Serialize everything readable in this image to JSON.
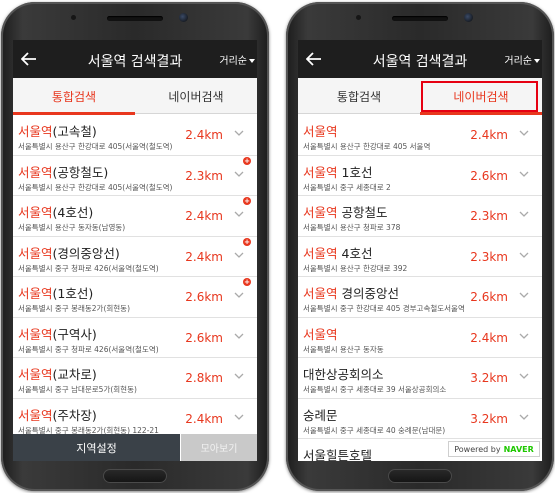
{
  "left": {
    "header": {
      "title": "서울역 검색결과",
      "sort_label": "거리순"
    },
    "tabs": {
      "integrated": "통합검색",
      "naver": "네이버검색"
    },
    "items": [
      {
        "highlight": "서울역",
        "suffix": "(고속철)",
        "address": "서울특별시 용산구 한강대로 405(서울역(철도역)",
        "distance": "2.4km",
        "badge": false
      },
      {
        "highlight": "서울역",
        "suffix": "(공항철도)",
        "address": "서울특별시 용산구 한강대로 405(서울역(철도역)",
        "distance": "2.3km",
        "badge": true
      },
      {
        "highlight": "서울역",
        "suffix": "(4호선)",
        "address": "서울특별시 용산구 동자동(남영동)",
        "distance": "2.4km",
        "badge": true
      },
      {
        "highlight": "서울역",
        "suffix": "(경의중앙선)",
        "address": "서울특별시 중구 청파로 426(서울역(철도역)",
        "distance": "2.4km",
        "badge": true
      },
      {
        "highlight": "서울역",
        "suffix": "(1호선)",
        "address": "서울특별시 중구 봉래동2가(회현동)",
        "distance": "2.6km",
        "badge": true
      },
      {
        "highlight": "서울역",
        "suffix": "(구역사)",
        "address": "서울특별시 중구 청파로 426(서울역(철도역)",
        "distance": "2.6km",
        "badge": false
      },
      {
        "highlight": "서울역",
        "suffix": "(교차로)",
        "address": "서울특별시 중구 남대문로5가(회현동)",
        "distance": "2.8km",
        "badge": false
      },
      {
        "highlight": "서울역",
        "suffix": "(주차장)",
        "address": "서울특별시 중구 봉래동2가(회현동) 122-21",
        "distance": "2.4km",
        "badge": false
      }
    ],
    "bottom": {
      "region": "지역설정",
      "collect": "모아보기"
    }
  },
  "right": {
    "header": {
      "title": "서울역 검색결과",
      "sort_label": "거리순"
    },
    "tabs": {
      "integrated": "통합검색",
      "naver": "네이버검색"
    },
    "items": [
      {
        "highlight": "서울역",
        "suffix": "",
        "address": "서울특별시 용산구 한강대로 405 서울역",
        "distance": "2.4km"
      },
      {
        "highlight": "서울역",
        "suffix": " 1호선",
        "address": "서울특별시 중구 세종대로 2",
        "distance": "2.6km"
      },
      {
        "highlight": "서울역",
        "suffix": " 공항철도",
        "address": "서울특별시 용산구 청파로 378",
        "distance": "2.3km"
      },
      {
        "highlight": "서울역",
        "suffix": " 4호선",
        "address": "서울특별시 용산구 한강대로 392",
        "distance": "2.3km"
      },
      {
        "highlight": "서울역",
        "suffix": " 경의중앙선",
        "address": "서울특별시 중구 한강대로 405 경부고속철도서울역",
        "distance": "2.6km"
      },
      {
        "highlight": "서울역",
        "suffix": "",
        "address": "서울특별시 용산구 동자동",
        "distance": "2.4km"
      },
      {
        "highlight": "",
        "suffix": "대한상공회의소",
        "address": "서울특별시 중구 세종대로 39 서울상공회의소",
        "distance": "3.2km"
      },
      {
        "highlight": "",
        "suffix": "숭례문",
        "address": "서울특별시 중구 세종대로 40 숭례문(남대문)",
        "distance": "3.2km"
      },
      {
        "highlight": "",
        "suffix": "서울힐튼호텔",
        "address": "",
        "distance": ""
      }
    ],
    "naver_badge": {
      "prefix": "Powered by",
      "brand": "NAVER"
    }
  },
  "colors": {
    "accent": "#e8371e",
    "header": "#1e1e1e",
    "bottom_bar": "#3a4148",
    "naver_green": "#1ec800"
  }
}
